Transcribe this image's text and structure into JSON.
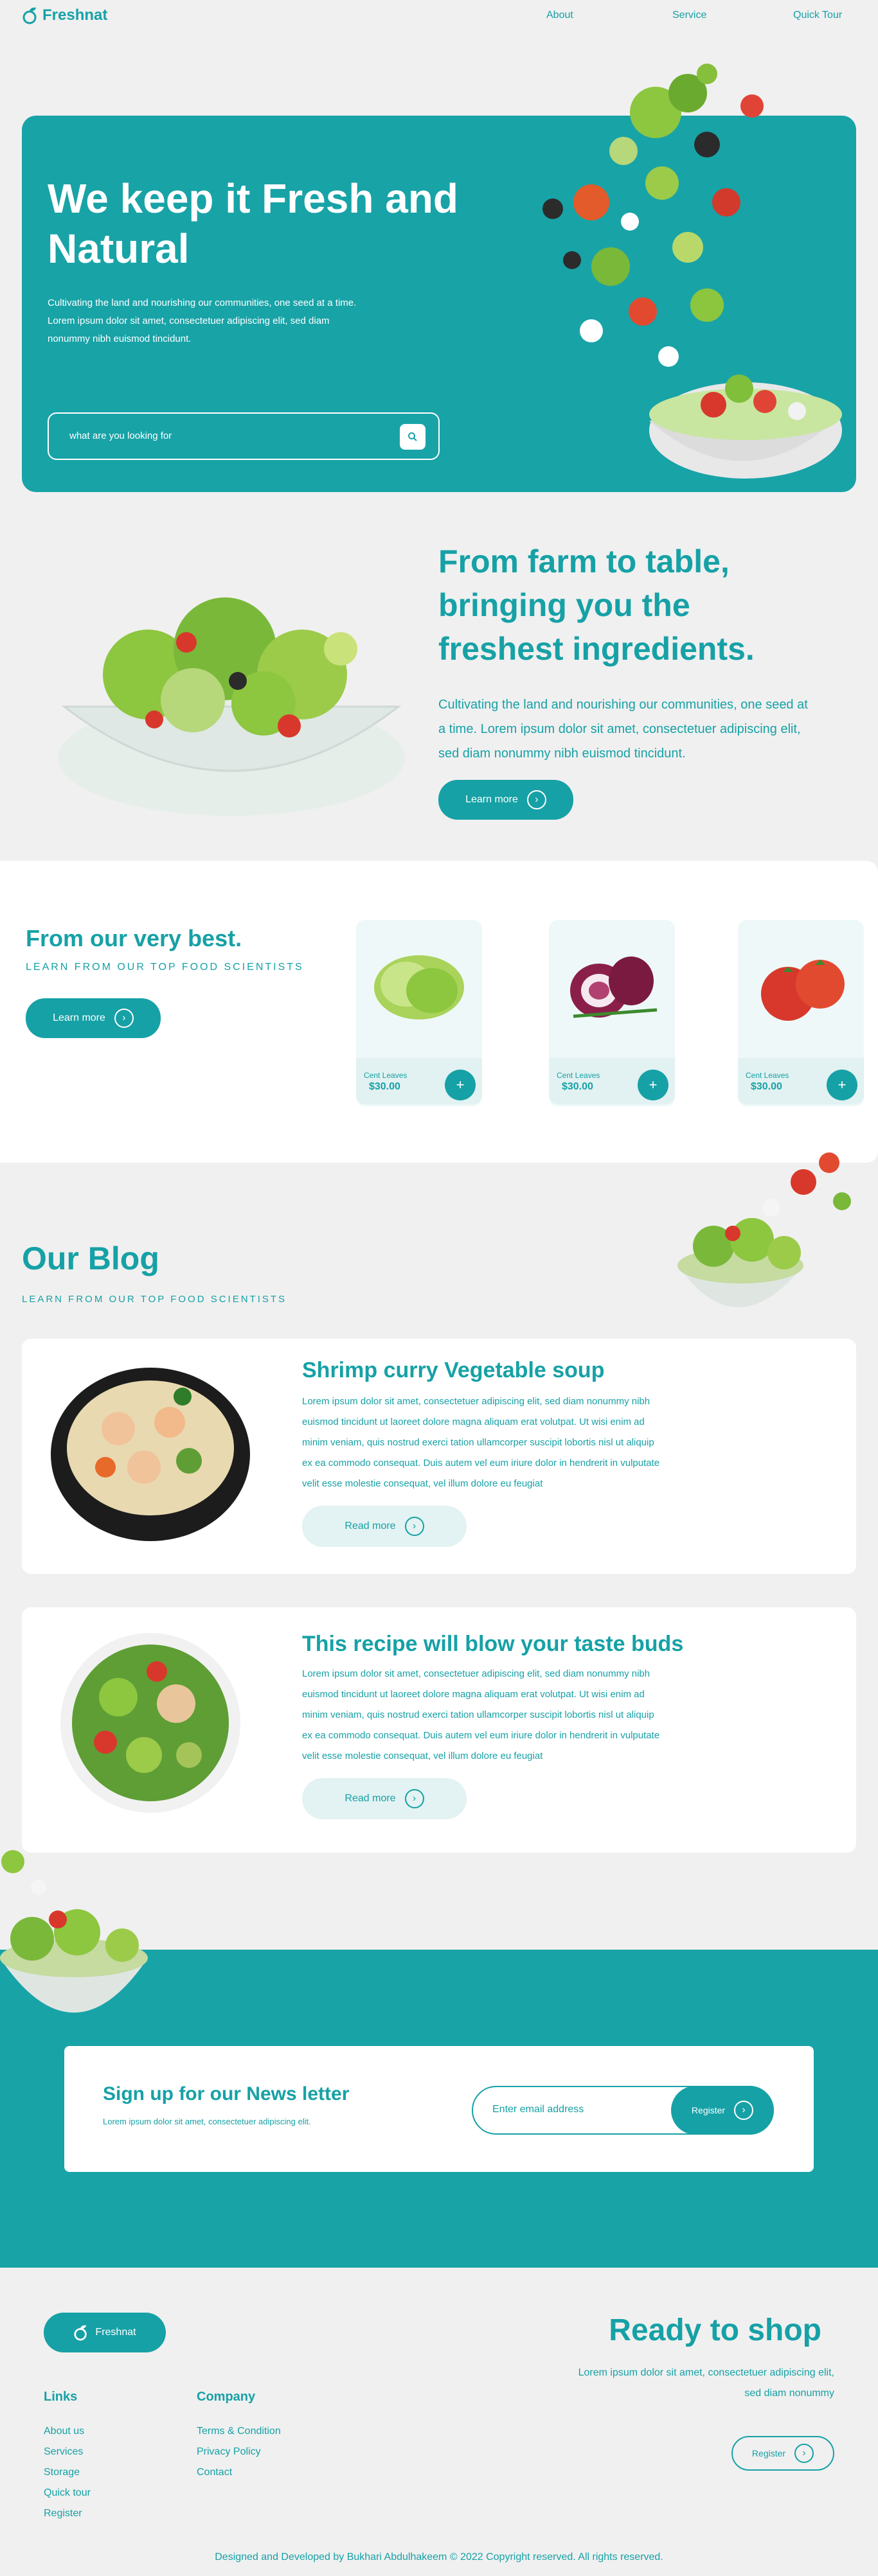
{
  "brand": {
    "name": "Freshnat",
    "accent": "#16a1a6"
  },
  "nav": {
    "links": [
      "About",
      "Service",
      "Quick Tour"
    ]
  },
  "hero": {
    "title": "We keep it Fresh and Natural",
    "description": "Cultivating the land and nourishing our communities, one seed at a time. Lorem ipsum dolor sit amet, consectetuer adipiscing elit, sed diam nonummy nibh euismod tincidunt.",
    "search_placeholder": "what are you looking for",
    "search_icon": "search-icon"
  },
  "farm": {
    "title": "From farm to table, bringing you the freshest ingredients.",
    "description": "Cultivating the land and nourishing our communities, one seed at a time. Lorem ipsum dolor sit amet, consectetuer adipiscing elit, sed diam nonummy nibh euismod tincidunt.",
    "button": "Learn more"
  },
  "best": {
    "title": "From our very best.",
    "subtitle": "LEARN FROM OUR TOP FOOD SCIENTISTS",
    "button": "Learn more",
    "products": [
      {
        "name": "Cent Leaves",
        "price": "$30.00",
        "add": "+",
        "icon": "lettuce-image"
      },
      {
        "name": "Cent Leaves",
        "price": "$30.00",
        "add": "+",
        "icon": "onion-image"
      },
      {
        "name": "Cent Leaves",
        "price": "$30.00",
        "add": "+",
        "icon": "tomato-image"
      }
    ]
  },
  "blog": {
    "title": "Our Blog",
    "subtitle": "LEARN FROM OUR TOP FOOD SCIENTISTS",
    "posts": [
      {
        "title": "Shrimp curry Vegetable soup",
        "body": "Lorem ipsum dolor sit amet, consectetuer adipiscing elit, sed diam nonummy nibh euismod tincidunt ut laoreet dolore magna aliquam erat volutpat. Ut wisi enim ad minim veniam, quis nostrud exerci tation ullamcorper suscipit lobortis nisl ut aliquip ex ea commodo consequat. Duis autem vel eum iriure dolor in hendrerit in vulputate velit esse molestie consequat, vel illum dolore eu feugiat",
        "button": "Read more",
        "image": "shrimp-soup-image"
      },
      {
        "title": "This recipe will blow your taste buds",
        "body": "Lorem ipsum dolor sit amet, consectetuer adipiscing elit, sed diam nonummy nibh euismod tincidunt ut laoreet dolore magna aliquam erat volutpat. Ut wisi enim ad minim veniam, quis nostrud exerci tation ullamcorper suscipit lobortis nisl ut aliquip ex ea commodo consequat. Duis autem vel eum iriure dolor in hendrerit in vulputate velit esse molestie consequat, vel illum dolore eu feugiat",
        "button": "Read more",
        "image": "salad-bowl-image"
      }
    ]
  },
  "newsletter": {
    "title": "Sign up for our News letter",
    "subtitle": "Lorem ipsum dolor sit amet, consectetuer adipiscing elit.",
    "placeholder": "Enter email address",
    "button": "Register"
  },
  "footer": {
    "logo_label": "Freshnat",
    "links_heading": "Links",
    "links": [
      "About us",
      "Services",
      "Storage",
      "Quick tour",
      "Register"
    ],
    "company_heading": "Company",
    "company": [
      "Terms & Condition",
      "Privacy Policy",
      "Contact"
    ],
    "ready_title": "Ready to shop",
    "ready_desc": "Lorem ipsum dolor sit amet, consectetuer adipiscing elit, sed diam nonummy",
    "ready_button": "Register",
    "copyright": "Designed and Developed by Bukhari Abdulhakeem © 2022 Copyright reserved. All rights reserved."
  }
}
